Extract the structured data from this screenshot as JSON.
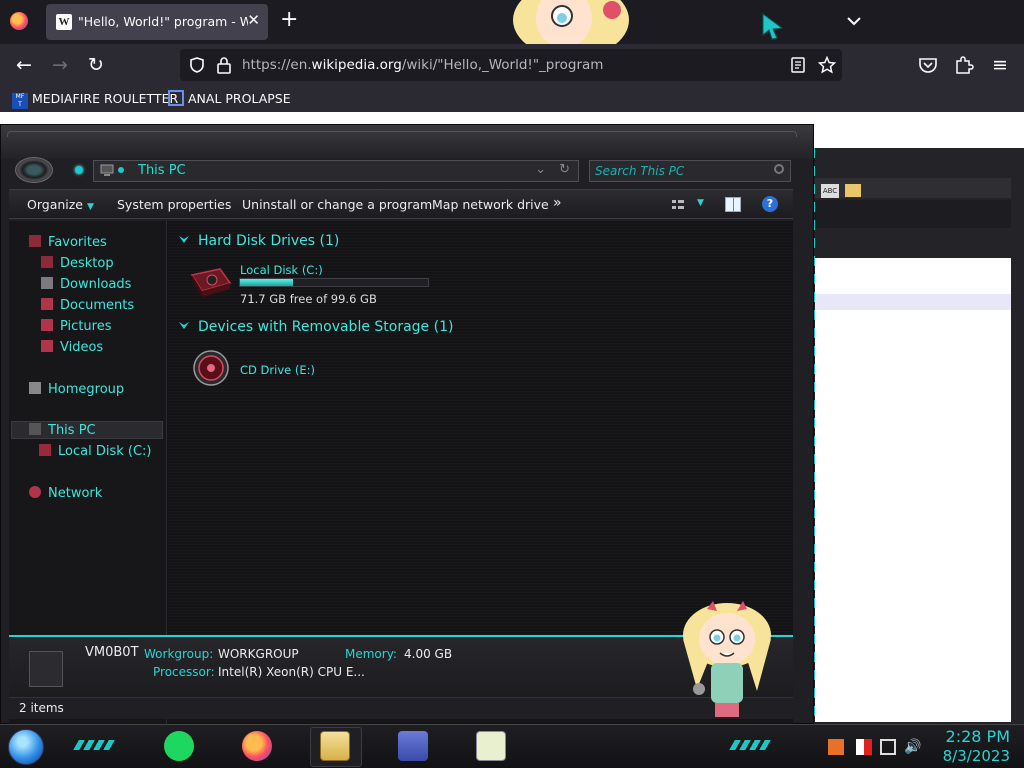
{
  "browser": {
    "tab": {
      "title": "\"Hello, World!\" program - Wiki",
      "favicon": "W"
    },
    "url": {
      "scheme_host_prefix": "https://en.",
      "domain": "wikipedia.org",
      "path": "/wiki/\"Hello,_World!\"_program"
    },
    "bookmarks": [
      {
        "label": "MEDIAFIRE ROULETTER",
        "icon": "mediafire-icon"
      },
      {
        "label": "ANAL PROLAPSE",
        "icon": "bookmark-icon"
      }
    ]
  },
  "explorer": {
    "address": "This PC",
    "search_placeholder": "Search This PC",
    "toolbar": {
      "organize": "Organize",
      "system_properties": "System properties",
      "uninstall": "Uninstall or change a program",
      "map_drive": "Map network drive",
      "overflow": "»"
    },
    "nav": {
      "favorites": "Favorites",
      "desktop": "Desktop",
      "downloads": "Downloads",
      "documents": "Documents",
      "pictures": "Pictures",
      "videos": "Videos",
      "homegroup": "Homegroup",
      "this_pc": "This PC",
      "local_disk": "Local Disk (C:)",
      "network": "Network"
    },
    "groups": {
      "hdd": "Hard Disk Drives (1)",
      "removable": "Devices with Removable Storage (1)"
    },
    "drives": {
      "c_label": "Local Disk (C:)",
      "c_free": "71.7 GB free of 99.6 GB",
      "c_used_fraction": 0.28,
      "e_label": "CD Drive (E:)"
    },
    "details": {
      "pc_name": "VM0B0T",
      "workgroup_label": "Workgroup:",
      "workgroup_value": "WORKGROUP",
      "memory_label": "Memory:",
      "memory_value": "4.00 GB",
      "processor_label": "Processor:",
      "processor_value": "Intel(R) Xeon(R) CPU E..."
    },
    "status": "2 items"
  },
  "taskbar": {
    "time": "2:28 PM",
    "date": "8/3/2023"
  },
  "colors": {
    "accent": "#2ad3d3",
    "text_cyan": "#3ee6dc"
  }
}
